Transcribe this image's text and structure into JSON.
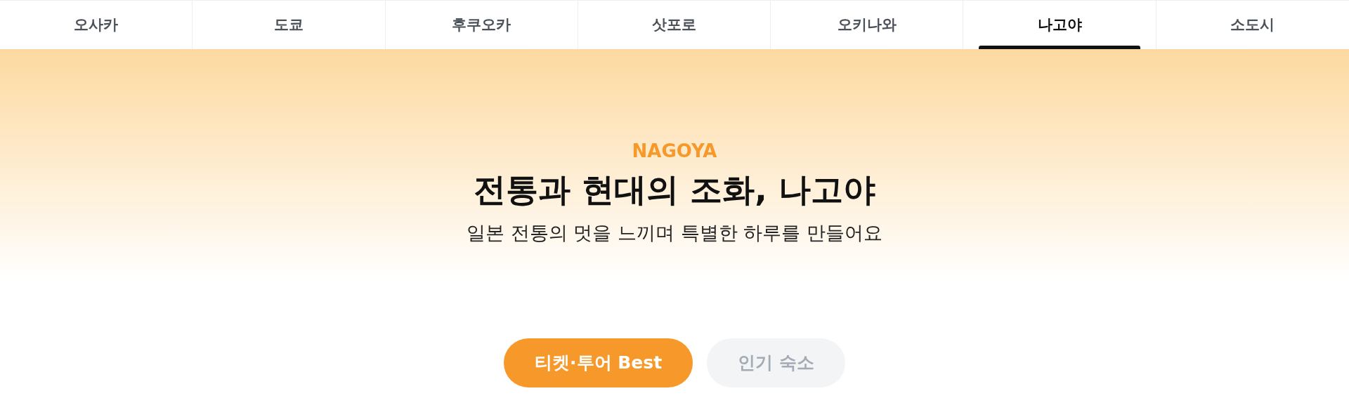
{
  "tabs": [
    {
      "label": "오사카",
      "selected": false
    },
    {
      "label": "도쿄",
      "selected": false
    },
    {
      "label": "후쿠오카",
      "selected": false
    },
    {
      "label": "삿포로",
      "selected": false
    },
    {
      "label": "오키나와",
      "selected": false
    },
    {
      "label": "나고야",
      "selected": true
    },
    {
      "label": "소도시",
      "selected": false
    }
  ],
  "hero": {
    "eyebrow": "NAGOYA",
    "title": "전통과 현대의 조화, 나고야",
    "subtitle": "일본 전통의 멋을 느끼며 특별한 하루를 만들어요"
  },
  "filters": [
    {
      "label": "티켓·투어 Best",
      "selected": true
    },
    {
      "label": "인기 숙소",
      "selected": false
    }
  ]
}
